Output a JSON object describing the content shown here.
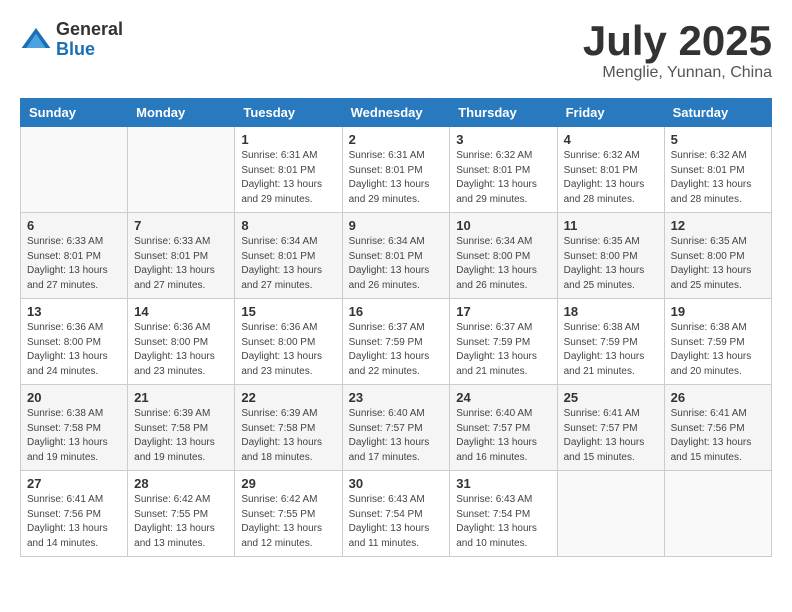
{
  "logo": {
    "general": "General",
    "blue": "Blue"
  },
  "title": {
    "month_year": "July 2025",
    "location": "Menglie, Yunnan, China"
  },
  "headers": [
    "Sunday",
    "Monday",
    "Tuesday",
    "Wednesday",
    "Thursday",
    "Friday",
    "Saturday"
  ],
  "weeks": [
    [
      {
        "day": "",
        "sunrise": "",
        "sunset": "",
        "daylight": ""
      },
      {
        "day": "",
        "sunrise": "",
        "sunset": "",
        "daylight": ""
      },
      {
        "day": "1",
        "sunrise": "Sunrise: 6:31 AM",
        "sunset": "Sunset: 8:01 PM",
        "daylight": "Daylight: 13 hours and 29 minutes."
      },
      {
        "day": "2",
        "sunrise": "Sunrise: 6:31 AM",
        "sunset": "Sunset: 8:01 PM",
        "daylight": "Daylight: 13 hours and 29 minutes."
      },
      {
        "day": "3",
        "sunrise": "Sunrise: 6:32 AM",
        "sunset": "Sunset: 8:01 PM",
        "daylight": "Daylight: 13 hours and 29 minutes."
      },
      {
        "day": "4",
        "sunrise": "Sunrise: 6:32 AM",
        "sunset": "Sunset: 8:01 PM",
        "daylight": "Daylight: 13 hours and 28 minutes."
      },
      {
        "day": "5",
        "sunrise": "Sunrise: 6:32 AM",
        "sunset": "Sunset: 8:01 PM",
        "daylight": "Daylight: 13 hours and 28 minutes."
      }
    ],
    [
      {
        "day": "6",
        "sunrise": "Sunrise: 6:33 AM",
        "sunset": "Sunset: 8:01 PM",
        "daylight": "Daylight: 13 hours and 27 minutes."
      },
      {
        "day": "7",
        "sunrise": "Sunrise: 6:33 AM",
        "sunset": "Sunset: 8:01 PM",
        "daylight": "Daylight: 13 hours and 27 minutes."
      },
      {
        "day": "8",
        "sunrise": "Sunrise: 6:34 AM",
        "sunset": "Sunset: 8:01 PM",
        "daylight": "Daylight: 13 hours and 27 minutes."
      },
      {
        "day": "9",
        "sunrise": "Sunrise: 6:34 AM",
        "sunset": "Sunset: 8:01 PM",
        "daylight": "Daylight: 13 hours and 26 minutes."
      },
      {
        "day": "10",
        "sunrise": "Sunrise: 6:34 AM",
        "sunset": "Sunset: 8:00 PM",
        "daylight": "Daylight: 13 hours and 26 minutes."
      },
      {
        "day": "11",
        "sunrise": "Sunrise: 6:35 AM",
        "sunset": "Sunset: 8:00 PM",
        "daylight": "Daylight: 13 hours and 25 minutes."
      },
      {
        "day": "12",
        "sunrise": "Sunrise: 6:35 AM",
        "sunset": "Sunset: 8:00 PM",
        "daylight": "Daylight: 13 hours and 25 minutes."
      }
    ],
    [
      {
        "day": "13",
        "sunrise": "Sunrise: 6:36 AM",
        "sunset": "Sunset: 8:00 PM",
        "daylight": "Daylight: 13 hours and 24 minutes."
      },
      {
        "day": "14",
        "sunrise": "Sunrise: 6:36 AM",
        "sunset": "Sunset: 8:00 PM",
        "daylight": "Daylight: 13 hours and 23 minutes."
      },
      {
        "day": "15",
        "sunrise": "Sunrise: 6:36 AM",
        "sunset": "Sunset: 8:00 PM",
        "daylight": "Daylight: 13 hours and 23 minutes."
      },
      {
        "day": "16",
        "sunrise": "Sunrise: 6:37 AM",
        "sunset": "Sunset: 7:59 PM",
        "daylight": "Daylight: 13 hours and 22 minutes."
      },
      {
        "day": "17",
        "sunrise": "Sunrise: 6:37 AM",
        "sunset": "Sunset: 7:59 PM",
        "daylight": "Daylight: 13 hours and 21 minutes."
      },
      {
        "day": "18",
        "sunrise": "Sunrise: 6:38 AM",
        "sunset": "Sunset: 7:59 PM",
        "daylight": "Daylight: 13 hours and 21 minutes."
      },
      {
        "day": "19",
        "sunrise": "Sunrise: 6:38 AM",
        "sunset": "Sunset: 7:59 PM",
        "daylight": "Daylight: 13 hours and 20 minutes."
      }
    ],
    [
      {
        "day": "20",
        "sunrise": "Sunrise: 6:38 AM",
        "sunset": "Sunset: 7:58 PM",
        "daylight": "Daylight: 13 hours and 19 minutes."
      },
      {
        "day": "21",
        "sunrise": "Sunrise: 6:39 AM",
        "sunset": "Sunset: 7:58 PM",
        "daylight": "Daylight: 13 hours and 19 minutes."
      },
      {
        "day": "22",
        "sunrise": "Sunrise: 6:39 AM",
        "sunset": "Sunset: 7:58 PM",
        "daylight": "Daylight: 13 hours and 18 minutes."
      },
      {
        "day": "23",
        "sunrise": "Sunrise: 6:40 AM",
        "sunset": "Sunset: 7:57 PM",
        "daylight": "Daylight: 13 hours and 17 minutes."
      },
      {
        "day": "24",
        "sunrise": "Sunrise: 6:40 AM",
        "sunset": "Sunset: 7:57 PM",
        "daylight": "Daylight: 13 hours and 16 minutes."
      },
      {
        "day": "25",
        "sunrise": "Sunrise: 6:41 AM",
        "sunset": "Sunset: 7:57 PM",
        "daylight": "Daylight: 13 hours and 15 minutes."
      },
      {
        "day": "26",
        "sunrise": "Sunrise: 6:41 AM",
        "sunset": "Sunset: 7:56 PM",
        "daylight": "Daylight: 13 hours and 15 minutes."
      }
    ],
    [
      {
        "day": "27",
        "sunrise": "Sunrise: 6:41 AM",
        "sunset": "Sunset: 7:56 PM",
        "daylight": "Daylight: 13 hours and 14 minutes."
      },
      {
        "day": "28",
        "sunrise": "Sunrise: 6:42 AM",
        "sunset": "Sunset: 7:55 PM",
        "daylight": "Daylight: 13 hours and 13 minutes."
      },
      {
        "day": "29",
        "sunrise": "Sunrise: 6:42 AM",
        "sunset": "Sunset: 7:55 PM",
        "daylight": "Daylight: 13 hours and 12 minutes."
      },
      {
        "day": "30",
        "sunrise": "Sunrise: 6:43 AM",
        "sunset": "Sunset: 7:54 PM",
        "daylight": "Daylight: 13 hours and 11 minutes."
      },
      {
        "day": "31",
        "sunrise": "Sunrise: 6:43 AM",
        "sunset": "Sunset: 7:54 PM",
        "daylight": "Daylight: 13 hours and 10 minutes."
      },
      {
        "day": "",
        "sunrise": "",
        "sunset": "",
        "daylight": ""
      },
      {
        "day": "",
        "sunrise": "",
        "sunset": "",
        "daylight": ""
      }
    ]
  ]
}
